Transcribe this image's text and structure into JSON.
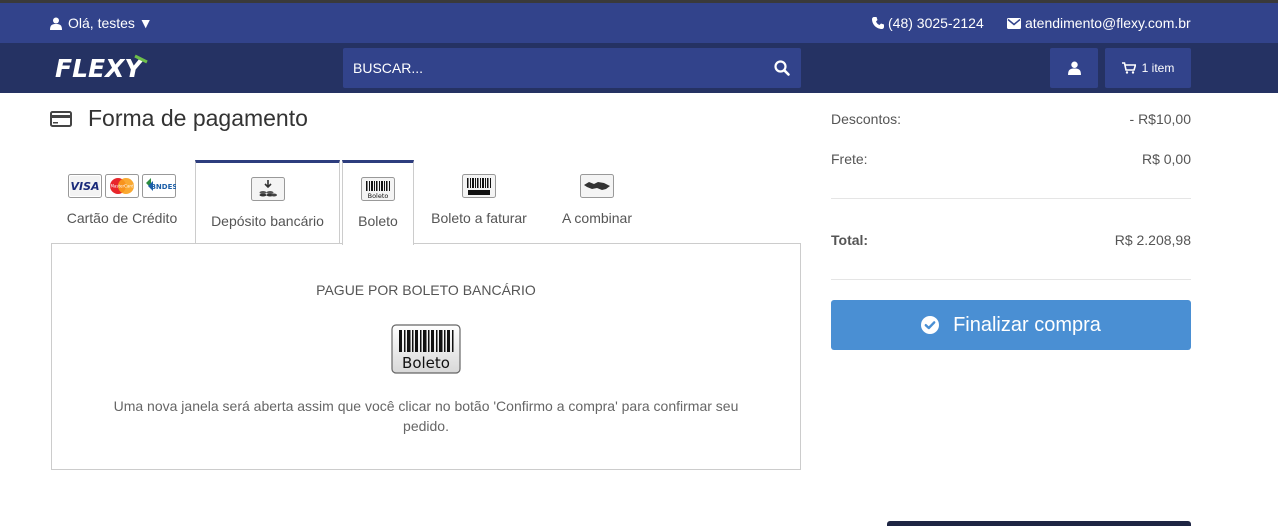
{
  "topbar": {
    "greeting": "Olá, testes ▼",
    "phone": "(48) 3025-2124",
    "email": "atendimento@flexy.com.br"
  },
  "navbar": {
    "logo_text": "FLEXY",
    "search_placeholder": "BUSCAR...",
    "cart_label": "1 item"
  },
  "payment": {
    "title": "Forma de pagamento",
    "tabs": [
      {
        "label": "Cartão de Crédito"
      },
      {
        "label": "Depósito bancário"
      },
      {
        "label": "Boleto"
      },
      {
        "label": "Boleto a faturar"
      },
      {
        "label": "A combinar"
      }
    ],
    "card_brands": [
      "VISA",
      "MasterCard",
      "BNDES"
    ],
    "panel": {
      "title": "PAGUE POR BOLETO BANCÁRIO",
      "icon_text": "Boleto",
      "description": "Uma nova janela será aberta assim que você clicar no botão 'Confirmo a compra' para confirmar seu pedido."
    }
  },
  "summary": {
    "discount_label": "Descontos:",
    "discount_value": "- R$10,00",
    "shipping_label": "Frete:",
    "shipping_value": "R$ 0,00",
    "total_label": "Total:",
    "total_value": "R$ 2.208,98",
    "checkout_label": "Finalizar compra"
  },
  "colors": {
    "topbar": "#32438b",
    "navbar": "#253263",
    "accent": "#4a8fd3",
    "tab_active_border": "#2d3d7e"
  }
}
